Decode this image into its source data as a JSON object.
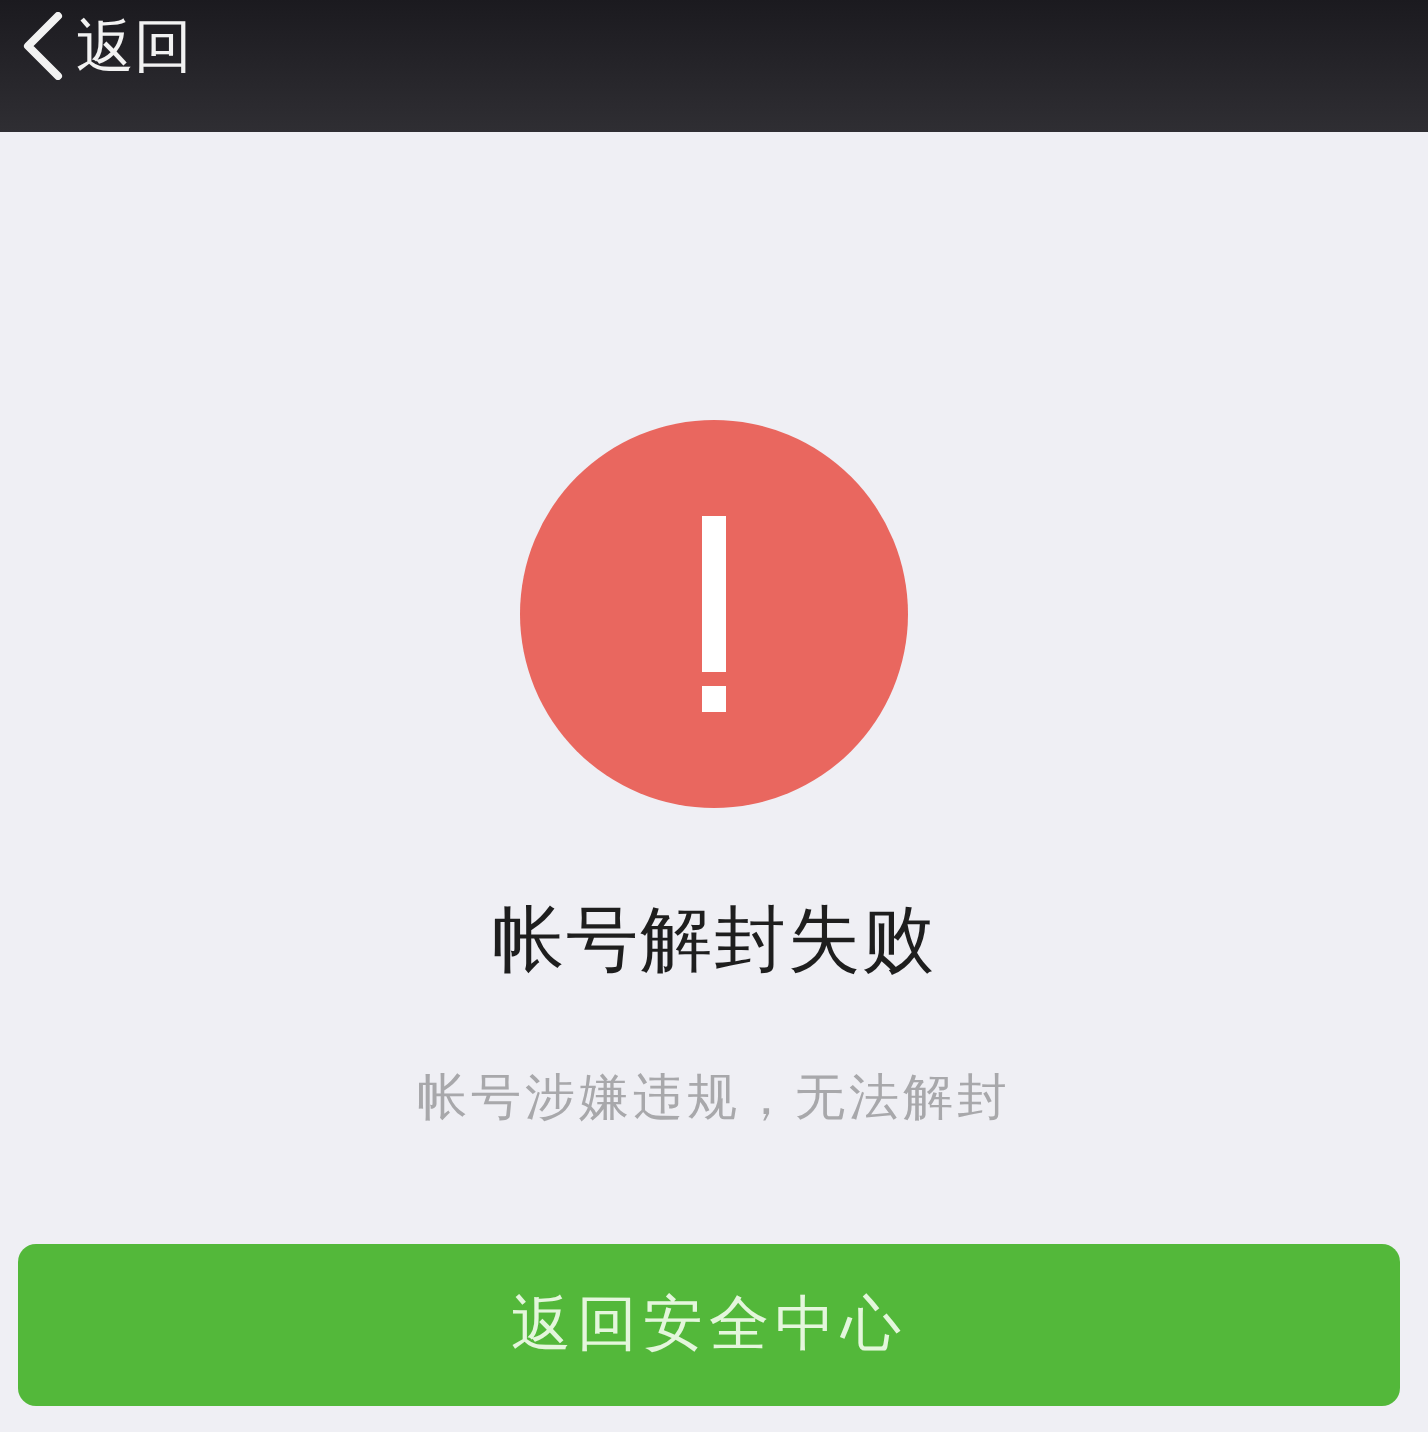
{
  "nav_bar": {
    "back_button": "返回"
  },
  "result": {
    "title": "帐号解封失败",
    "message": "帐号涉嫌违规，无法解封"
  },
  "buttons": [
    "返回安全中心"
  ]
}
